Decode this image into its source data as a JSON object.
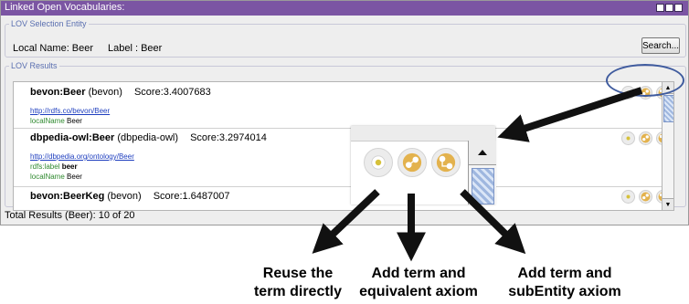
{
  "window": {
    "title": "Linked Open Vocabularies:"
  },
  "selection": {
    "legend": "LOV Selection Entity",
    "local_name": "Local Name: Beer",
    "label": "Label : Beer",
    "search_label": "Search..."
  },
  "results": {
    "legend": "LOV Results",
    "entries": [
      {
        "name": "bevon:Beer",
        "vocab": "(bevon)",
        "score": "Score:3.4007683",
        "uri": "http://rdfs.co/bevon/Beer",
        "props": [
          {
            "key": "localName",
            "value": "Beer"
          }
        ]
      },
      {
        "name": "dbpedia-owl:Beer",
        "vocab": "(dbpedia-owl)",
        "score": "Score:3.2974014",
        "uri": "http://dbpedia.org/ontology/Beer",
        "props": [
          {
            "key": "rdfs:label",
            "value": "beer"
          },
          {
            "key": "localName",
            "value": "Beer"
          }
        ]
      },
      {
        "name": "bevon:BeerKeg",
        "vocab": "(bevon)",
        "score": "Score:1.6487007"
      }
    ],
    "total": "Total Results (Beer): 10 of 20"
  },
  "annotations": {
    "reuse": [
      "Reuse the",
      "term directly"
    ],
    "equivalent": [
      "Add term and",
      "equivalent axiom"
    ],
    "subentity": [
      "Add term and",
      "subEntity axiom"
    ]
  },
  "icons": [
    "reuse-icon",
    "add-equivalent-icon",
    "add-subentity-icon"
  ],
  "colors": {
    "titlebar": "#7b55a3",
    "action_icon": "#e3b24d",
    "link": "#1f3fbf",
    "property": "#2f8a2f",
    "highlight": "#3f5b9e"
  }
}
